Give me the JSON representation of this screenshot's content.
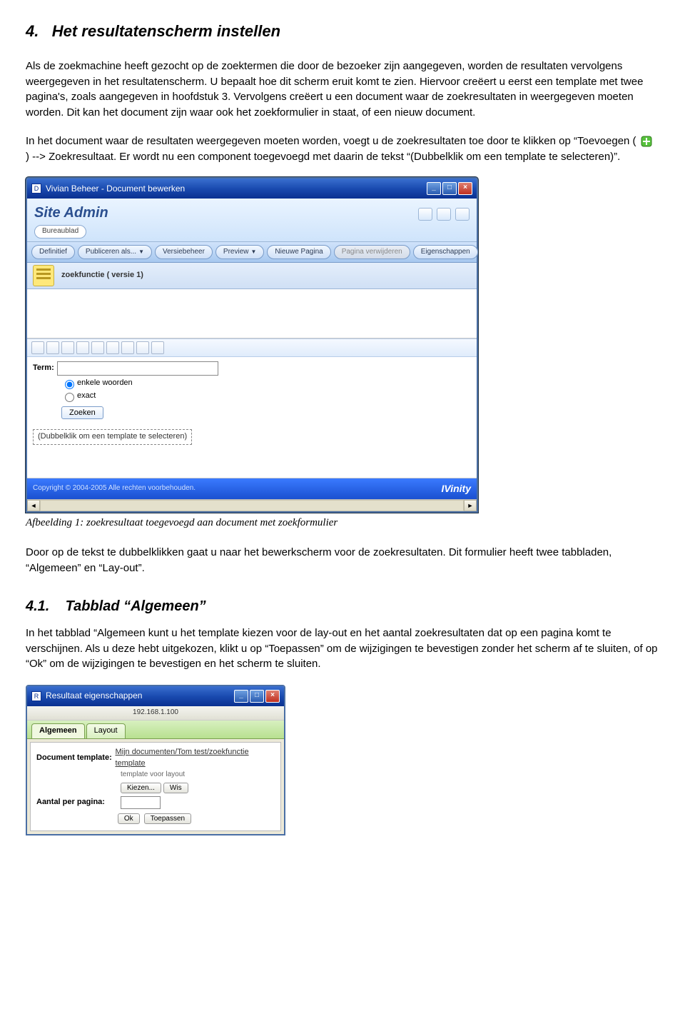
{
  "section": {
    "number": "4.",
    "title": "Het resultatenscherm instellen"
  },
  "paragraphs": {
    "p1": "Als de zoekmachine heeft gezocht op de zoektermen die door de bezoeker zijn aangegeven, worden de resultaten vervolgens weergegeven in het resultatenscherm. U bepaalt hoe dit scherm eruit komt te zien. Hiervoor creëert u eerst een template met twee pagina's, zoals aangegeven in hoofdstuk 3. Vervolgens creëert u een document waar de zoekresultaten in weergegeven moeten worden. Dit kan het document zijn waar ook het zoekformulier in staat, of een nieuw document.",
    "p2a": "In het document waar de resultaten weergegeven moeten worden, voegt u de zoekresultaten toe door te klikken op “Toevoegen (",
    "p2b": ") --> Zoekresultaat. Er wordt nu een component toegevoegd met daarin de tekst “(Dubbelklik om een template te selecteren)”.",
    "caption1": "Afbeelding 1: zoekresultaat toegevoegd aan document met zoekformulier",
    "p3": "Door op de tekst te dubbelklikken gaat u naar het bewerkscherm voor de zoekresultaten. Dit formulier heeft twee tabbladen, “Algemeen” en “Lay-out”.",
    "p4": "In het tabblad “Algemeen kunt u het template kiezen voor de lay-out en het aantal zoekresultaten dat op een pagina komt te verschijnen. Als u deze hebt uitgekozen, klikt u op “Toepassen” om de wijzigingen te bevestigen zonder het scherm af te sluiten, of op “Ok” om de wijzigingen te bevestigen en het scherm te sluiten."
  },
  "subsection": {
    "number": "4.1.",
    "title": "Tabblad “Algemeen”"
  },
  "screenshot1": {
    "window_title": "Vivian Beheer - Document bewerken",
    "site_admin": "Site Admin",
    "bureau": "Bureaublad",
    "toolbar": {
      "definitief": "Definitief",
      "publiceren": "Publiceren als...",
      "versiebeheer": "Versiebeheer",
      "preview": "Preview",
      "nieuwe_pagina": "Nieuwe Pagina",
      "pagina_verwijderen": "Pagina verwijderen",
      "eigenschappen": "Eigenschappen"
    },
    "doc_tab": "zoekfunctie ( versie 1)",
    "form": {
      "term_label": "Term:",
      "radio_enkele": "enkele woorden",
      "radio_exact": "exact",
      "zoeken": "Zoeken"
    },
    "placeholder_text": "(Dubbelklik om een template te selecteren)",
    "footer_copyright": "Copyright © 2004-2005 Alle rechten voorbehouden.",
    "footer_logo": "IVinity"
  },
  "screenshot2": {
    "window_title": "Resultaat eigenschappen",
    "ip": "192.168.1.100",
    "tabs": {
      "algemeen": "Algemeen",
      "layout": "Layout"
    },
    "doc_template_label": "Document template:",
    "doc_template_value": "Mijn documenten/Tom test/zoekfunctie template",
    "doc_template_sub": "template voor layout",
    "kiezen": "Kiezen...",
    "wis": "Wis",
    "aantal_label": "Aantal per pagina:",
    "ok": "Ok",
    "toepassen": "Toepassen"
  }
}
